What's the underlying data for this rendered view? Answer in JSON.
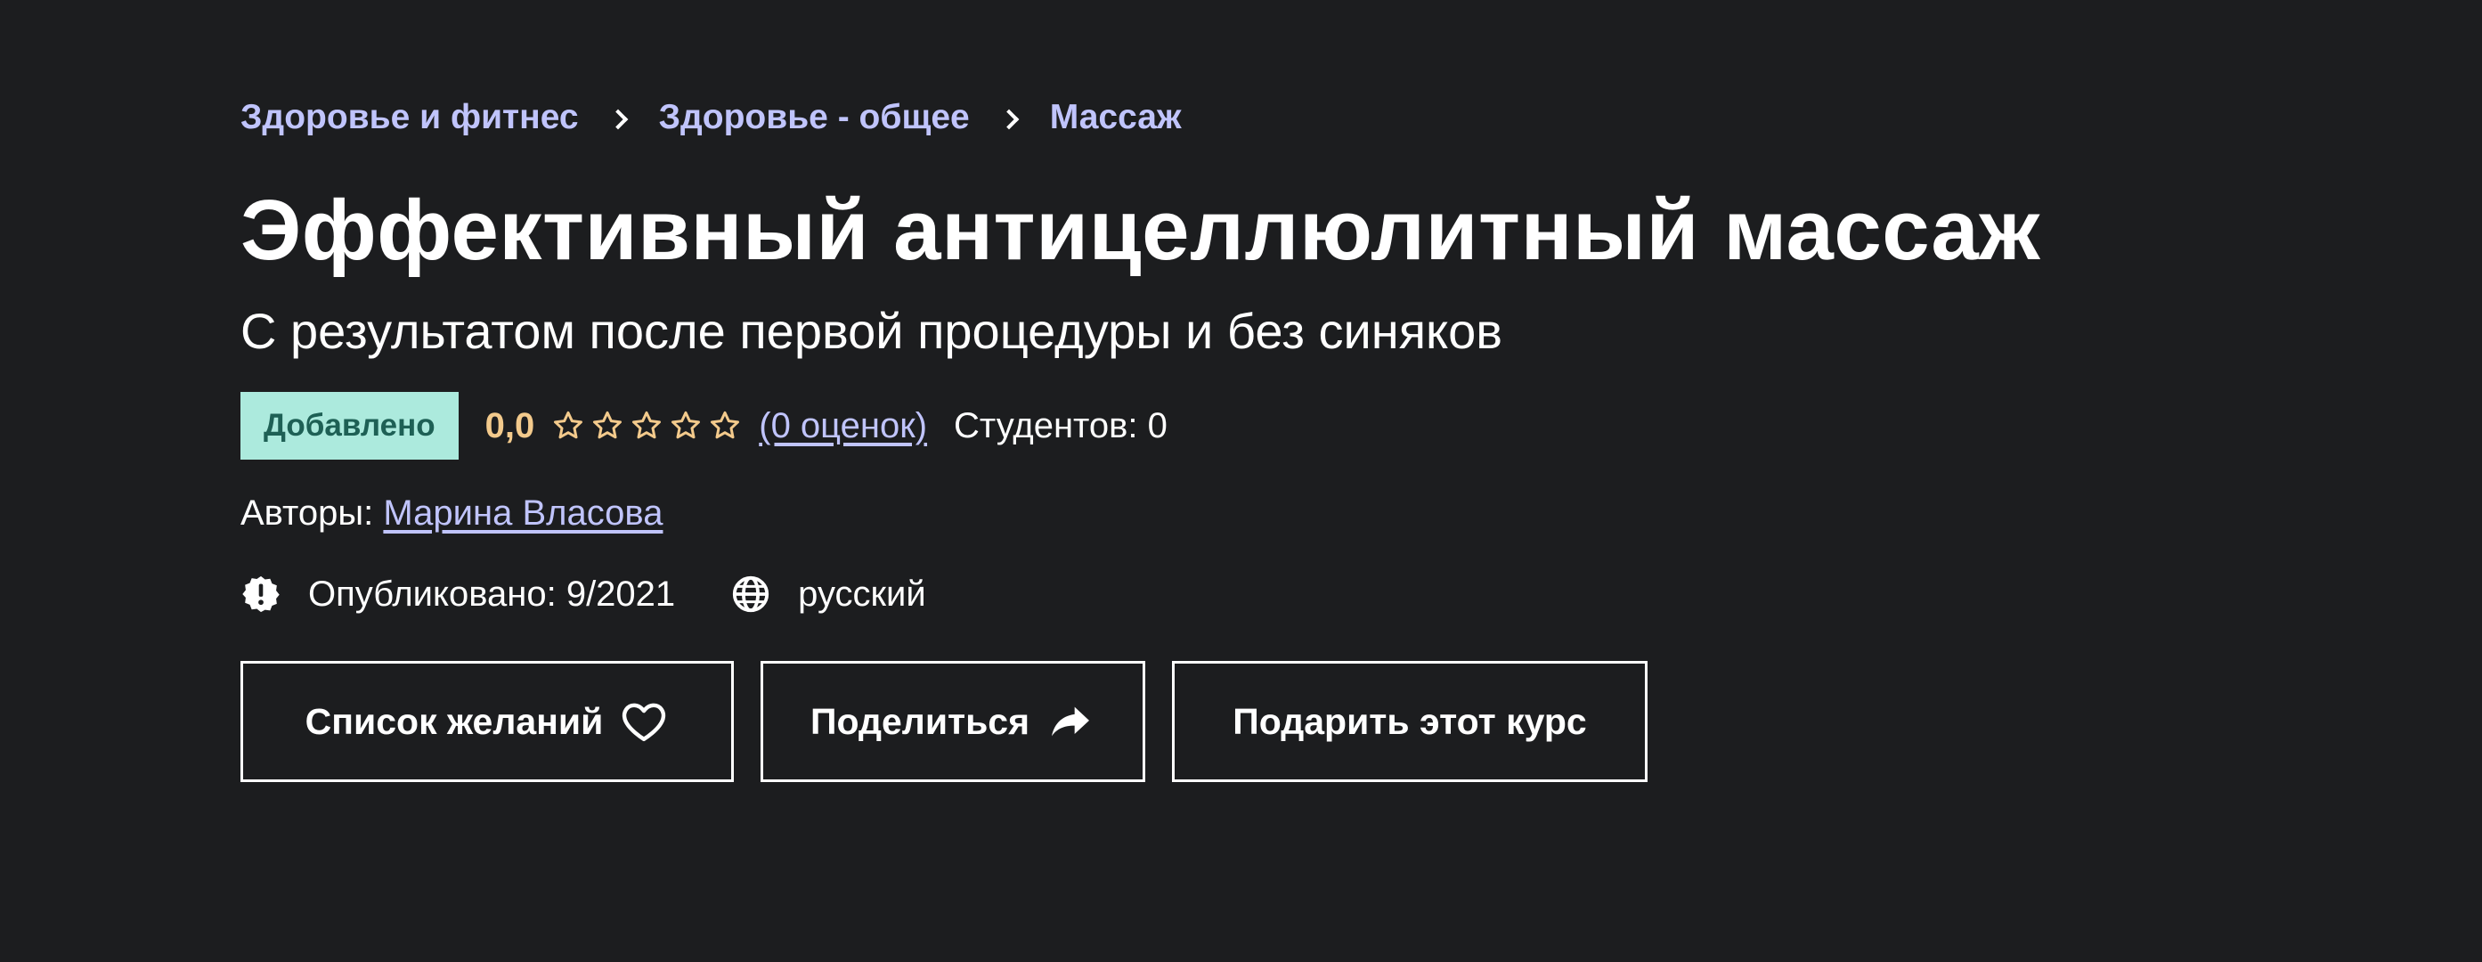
{
  "breadcrumb": {
    "items": [
      {
        "label": "Здоровье и фитнес"
      },
      {
        "label": "Здоровье - общее"
      },
      {
        "label": "Массаж"
      }
    ]
  },
  "course": {
    "title": "Эффективный антицеллюлитный массаж",
    "subtitle": "С результатом после первой процедуры и без синяков",
    "badge": "Добавлено",
    "rating_value": "0,0",
    "stars_filled": 0,
    "stars_total": 5,
    "rating_count": "(0 оценок)",
    "students": "Студентов: 0",
    "authors_label": "Авторы:",
    "author_name": "Марина Власова",
    "published": "Опубликовано: 9/2021",
    "language": "русский"
  },
  "actions": {
    "wishlist_label": "Список желаний",
    "share_label": "Поделиться",
    "gift_label": "Подарить этот курс"
  },
  "icons": {
    "breadcrumb_separator": "chevron-right-icon",
    "star": "star-outline-icon",
    "published": "alert-badge-icon",
    "language": "globe-icon",
    "wishlist": "heart-outline-icon",
    "share": "share-arrow-icon"
  },
  "colors": {
    "background": "#1c1d1f",
    "link": "#c0c4fc",
    "rating": "#f3ca8c",
    "badge_bg": "#aceadd",
    "badge_text": "#1e6055",
    "text": "#ffffff"
  }
}
